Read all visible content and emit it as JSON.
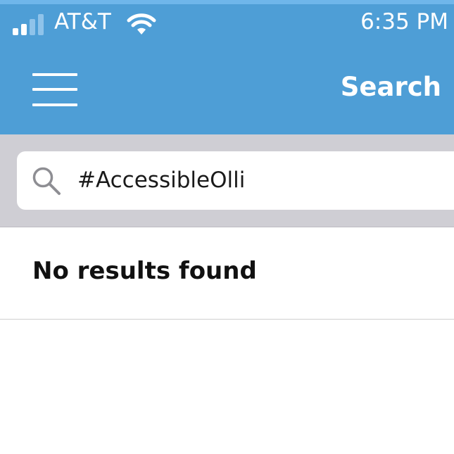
{
  "status_bar": {
    "carrier": "AT&T",
    "time": "6:35 PM",
    "signal_bars_filled": 2,
    "signal_bars_total": 4,
    "wifi_icon": "wifi-icon"
  },
  "nav": {
    "menu_icon": "hamburger-menu-icon",
    "title": "Search"
  },
  "search": {
    "value": "#AccessibleOlli",
    "icon": "search-icon"
  },
  "results": {
    "message": "No results found"
  },
  "colors": {
    "header": "#4e9ed6",
    "header_top": "#6fb6ea",
    "search_band": "#cfced4",
    "text": "#111111",
    "white": "#ffffff"
  }
}
